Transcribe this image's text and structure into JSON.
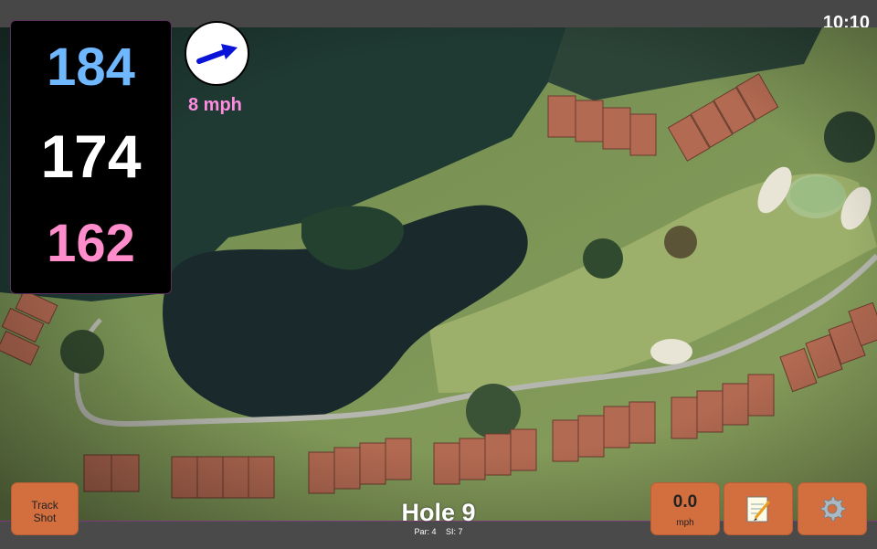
{
  "status": {
    "time": "10:10"
  },
  "yardage": {
    "back": "184",
    "middle": "174",
    "front": "162"
  },
  "wind": {
    "speed_label": "8 mph",
    "direction_icon": "arrow-icon"
  },
  "hole": {
    "title": "Hole 9",
    "par_label": "Par: 4",
    "si_label": "SI: 7"
  },
  "controls": {
    "track_shot_line1": "Track",
    "track_shot_line2": "Shot",
    "speed_value": "0.0",
    "speed_unit": "mph",
    "notes_icon": "notepad-icon",
    "settings_icon": "gear-icon"
  },
  "colors": {
    "back_yardage": "#6fb7ff",
    "middle_yardage": "#ffffff",
    "front_yardage": "#ff8ccb",
    "wind_label": "#ff8ce0",
    "button": "#d36f3f"
  }
}
